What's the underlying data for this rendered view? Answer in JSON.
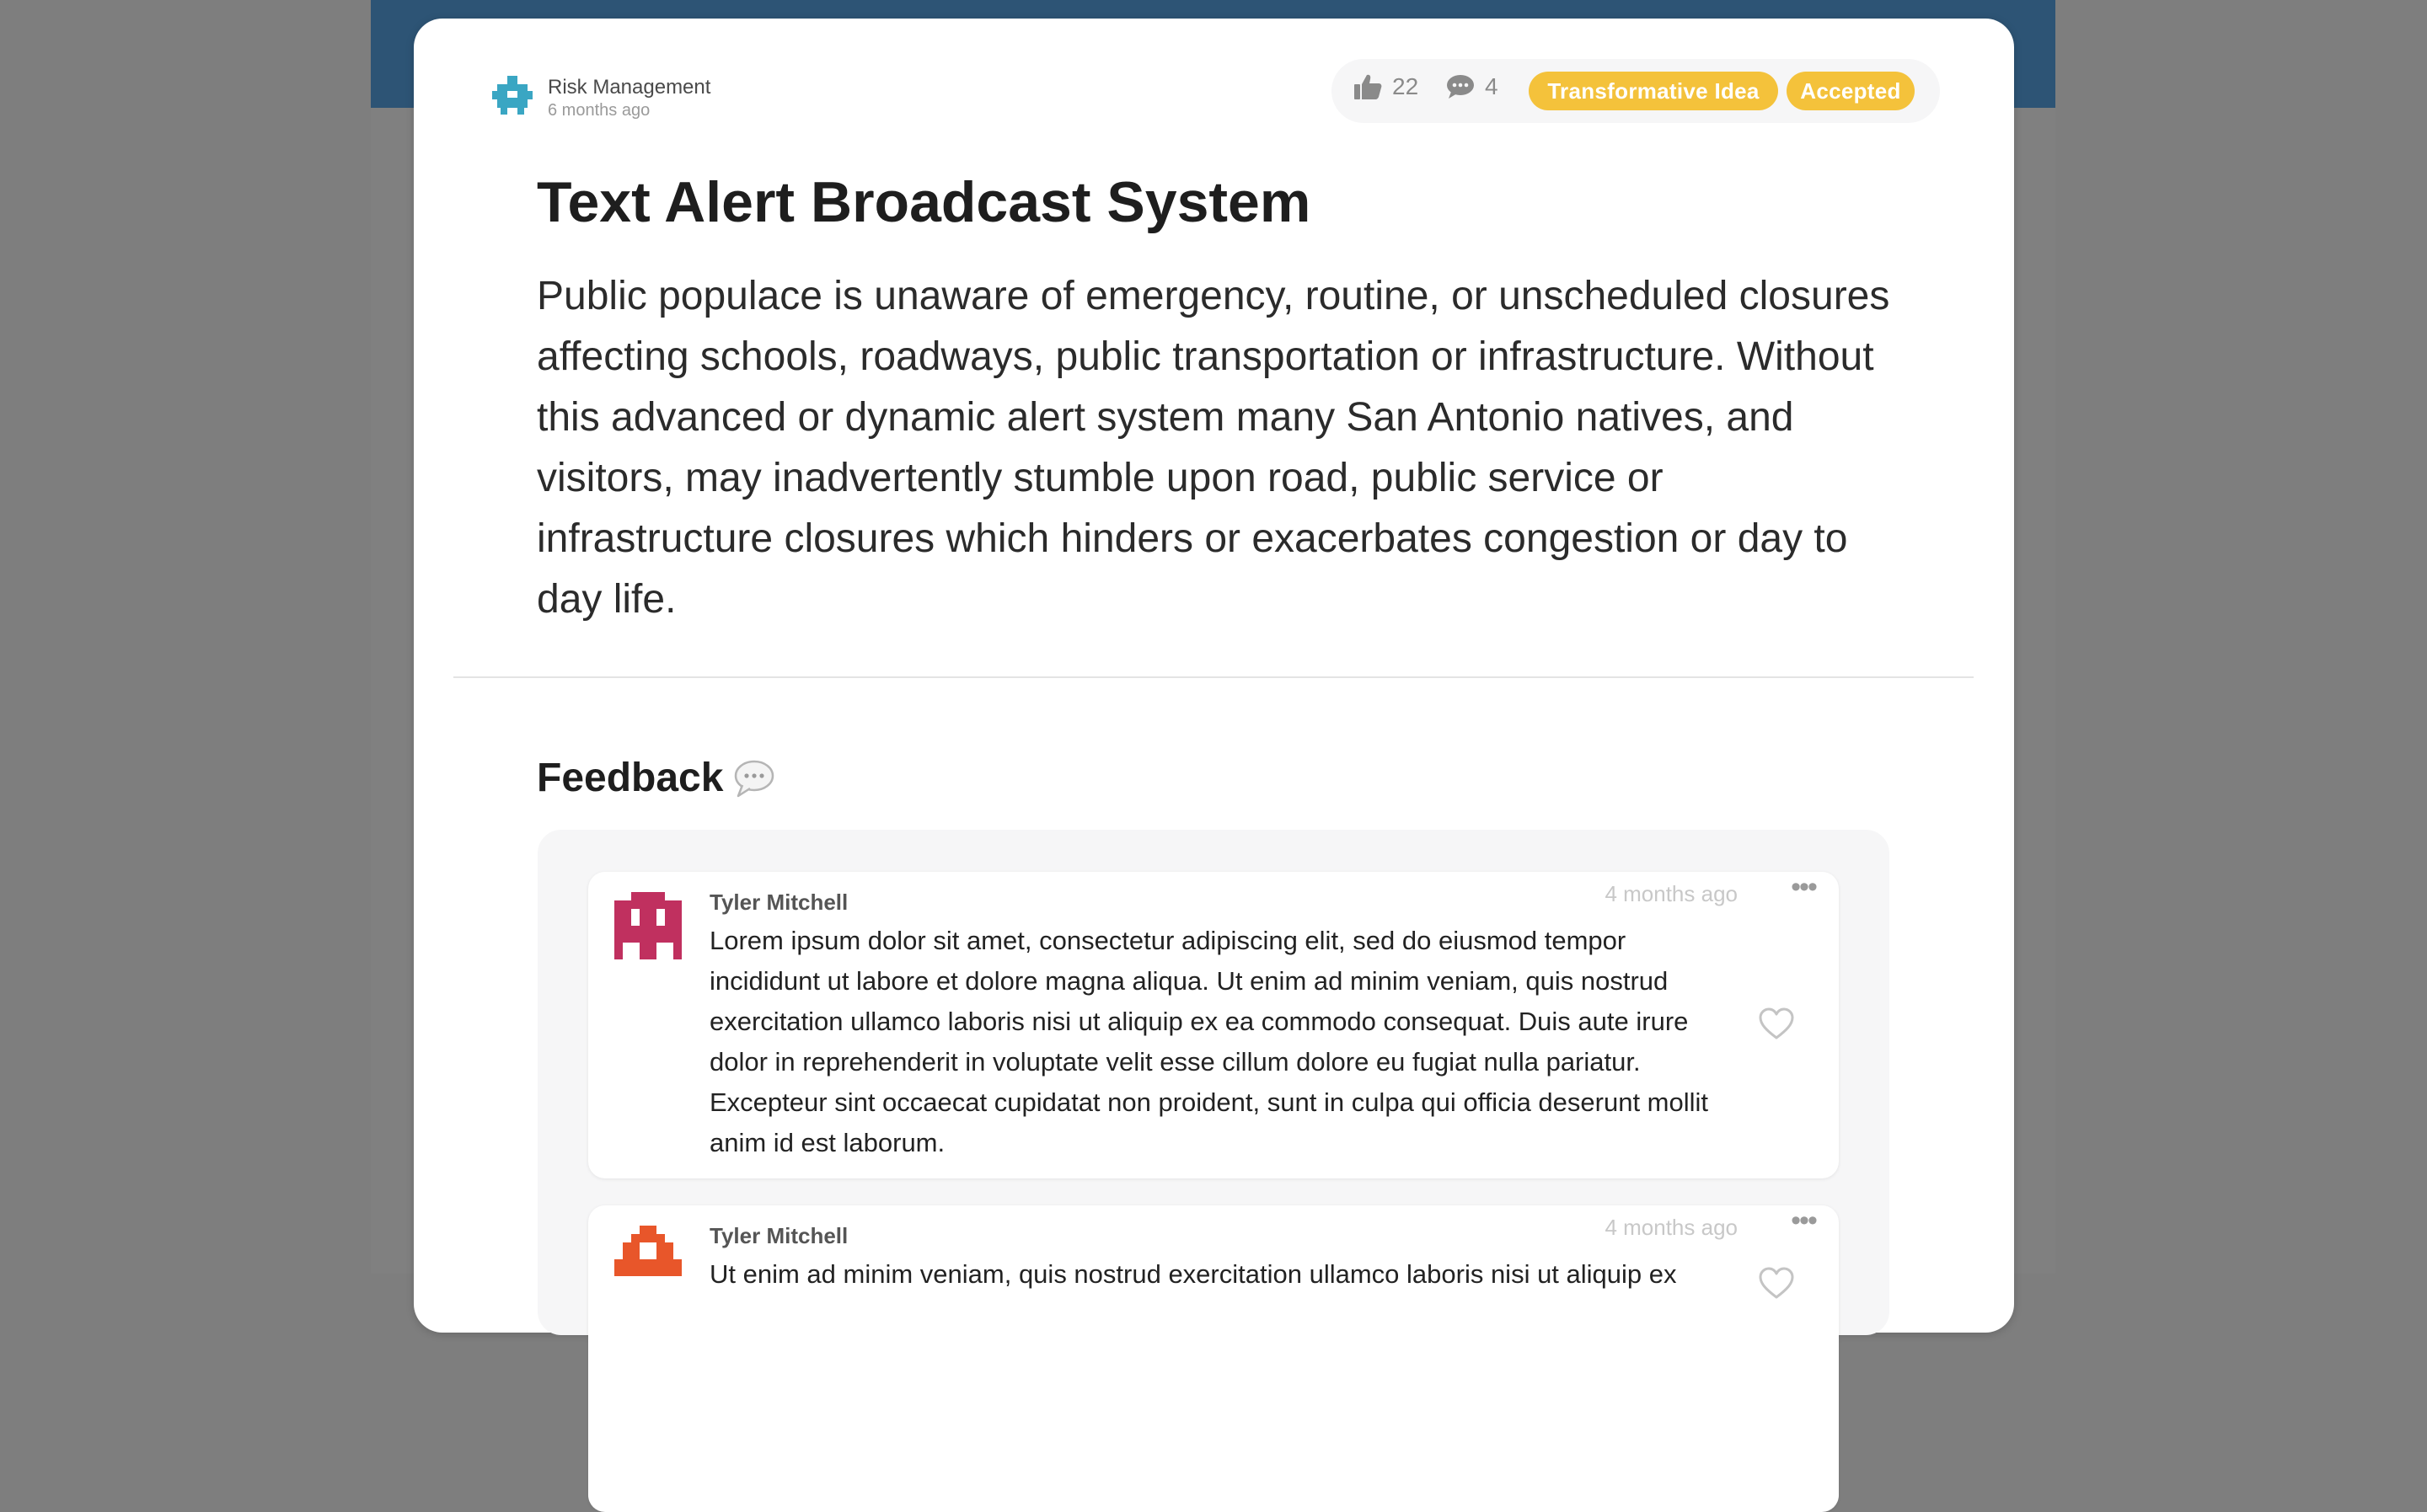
{
  "department": {
    "name": "Risk Management",
    "time": "6 months ago",
    "icon": "puzzle-icon"
  },
  "stats": {
    "votes": "22",
    "comments": "4"
  },
  "badges": [
    "Transformative Idea",
    "Accepted"
  ],
  "idea": {
    "title": "Text Alert Broadcast System",
    "description": "Public populace is unaware of emergency, routine, or unscheduled closures affecting schools, roadways, public transportation or infrastructure. Without this advanced or dynamic alert system many San Antonio natives, and visitors, may inadvertently stumble upon road, public service or infrastructure closures which hinders or exacerbates congestion or day to day life."
  },
  "feedback": {
    "title": "Feedback",
    "items": [
      {
        "author": "Tyler Mitchell",
        "time": "4 months ago",
        "avatar_color": "#c0305f",
        "text": "Lorem ipsum dolor sit amet, consectetur adipiscing elit, sed do eiusmod tempor incididunt ut labore et dolore magna aliqua. Ut enim ad minim veniam, quis nostrud exercitation ullamco laboris nisi ut aliquip ex ea commodo consequat. Duis aute irure dolor in reprehenderit in voluptate velit esse cillum dolore eu fugiat nulla pariatur. Excepteur sint occaecat cupidatat non proident, sunt in culpa qui officia deserunt mollit anim id est laborum."
      },
      {
        "author": "Tyler Mitchell",
        "time": "4 months ago",
        "avatar_color": "#e8562a",
        "text": "Ut enim ad minim veniam, quis nostrud exercitation ullamco laboris nisi ut aliquip ex"
      }
    ]
  },
  "colors": {
    "header": "#2d5475",
    "badge": "#f4c23b",
    "dept_icon": "#3aa6c3"
  }
}
